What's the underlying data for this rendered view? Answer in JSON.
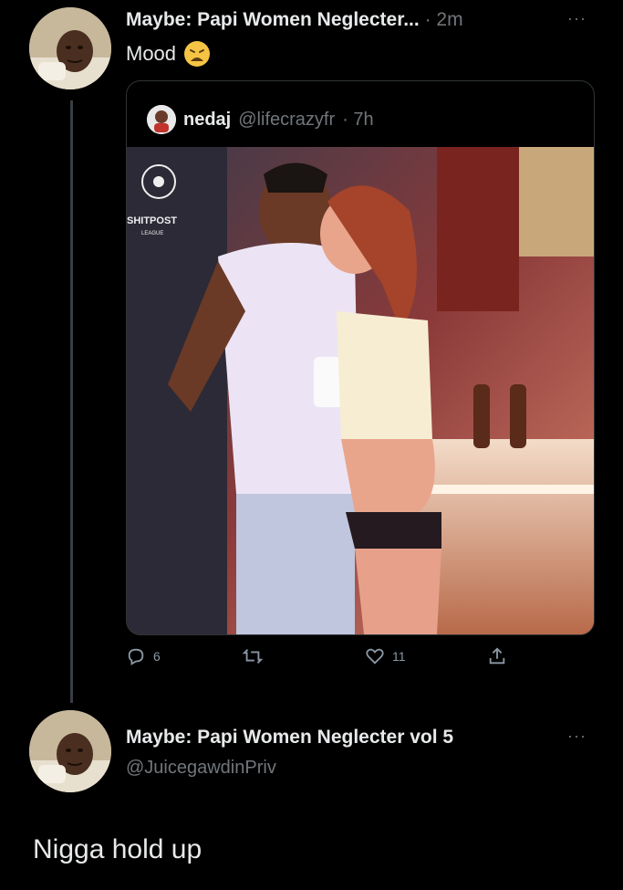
{
  "tweet": {
    "display_name": "Maybe: Papi Women Neglecter...",
    "time": "· 2m",
    "text": "Mood",
    "emoji_icon": "weary-face-emoji",
    "more_label": "···"
  },
  "quoted": {
    "display_name": "nedaj",
    "handle": "@lifecrazyfr",
    "time": "· 7h",
    "media_logo_text": "SHITPOST",
    "media_logo_subtext": "LEAGUE"
  },
  "actions": {
    "reply_count": "6",
    "retweet_count": "",
    "like_count": "11"
  },
  "reply": {
    "display_name": "Maybe: Papi Women Neglecter vol 5",
    "handle": "@JuicegawdinPriv",
    "text": "Nigga hold up",
    "more_label": "···"
  },
  "colors": {
    "background": "#000000",
    "text_primary": "#e7e9ea",
    "text_secondary": "#71767b",
    "border": "#2f3336"
  }
}
